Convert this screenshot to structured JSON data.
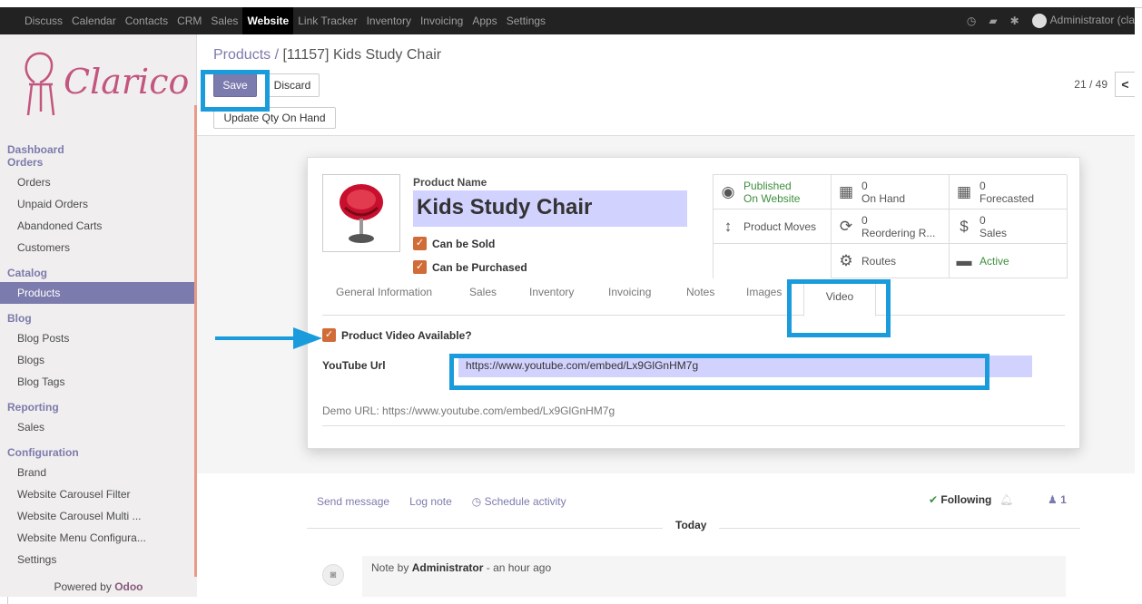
{
  "topnav": {
    "items": [
      "Discuss",
      "Calendar",
      "Contacts",
      "CRM",
      "Sales",
      "Website",
      "Link Tracker",
      "Inventory",
      "Invoicing",
      "Apps",
      "Settings"
    ],
    "active": "Website",
    "user": "Administrator (cla"
  },
  "sidebar": {
    "logo_text": "Clarico",
    "sections": {
      "dashboard": "Dashboard",
      "orders": "Orders",
      "orders_items": [
        "Orders",
        "Unpaid Orders",
        "Abandoned Carts",
        "Customers"
      ],
      "catalog": "Catalog",
      "catalog_items": [
        "Products"
      ],
      "blog": "Blog",
      "blog_items": [
        "Blog Posts",
        "Blogs",
        "Blog Tags"
      ],
      "reporting": "Reporting",
      "reporting_items": [
        "Sales"
      ],
      "configuration": "Configuration",
      "configuration_items": [
        "Brand",
        "Website Carousel Filter",
        "Website Carousel Multi ...",
        "Website Menu Configura...",
        "Settings"
      ]
    },
    "powered_prefix": "Powered by",
    "powered_brand": "Odoo"
  },
  "control_panel": {
    "breadcrumb_parent": "Products /",
    "breadcrumb_current": "[11157] Kids Study Chair",
    "save": "Save",
    "discard": "Discard",
    "update_qty": "Update Qty On Hand",
    "pager": "21 / 49",
    "pager_prev": "<"
  },
  "product": {
    "name_label": "Product Name",
    "name": "Kids Study Chair",
    "can_be_sold": "Can be Sold",
    "can_be_purchased": "Can be Purchased"
  },
  "stats": [
    {
      "icon": "globe-icon",
      "glyph": "◉",
      "line1": "Published",
      "line2": "On Website",
      "green": true
    },
    {
      "icon": "building-icon",
      "glyph": "▦",
      "line1": "0",
      "line2": "On Hand",
      "green": false
    },
    {
      "icon": "building-icon",
      "glyph": "▦",
      "line1": "0",
      "line2": "Forecasted",
      "green": false
    },
    {
      "icon": "arrows-vertical-icon",
      "glyph": "↕",
      "line1": "",
      "line2": "Product Moves",
      "green": false
    },
    {
      "icon": "refresh-icon",
      "glyph": "⟳",
      "line1": "0",
      "line2": "Reordering R...",
      "green": false
    },
    {
      "icon": "dollar-icon",
      "glyph": "$",
      "line1": "0",
      "line2": "Sales",
      "green": false
    },
    {
      "icon": "blank-icon",
      "glyph": "",
      "line1": "",
      "line2": "",
      "green": false
    },
    {
      "icon": "cogs-icon",
      "glyph": "⚙",
      "line1": "",
      "line2": "Routes",
      "green": false
    },
    {
      "icon": "archive-icon",
      "glyph": "▬",
      "line1": "",
      "line2": "Active",
      "green": true
    }
  ],
  "tabs": [
    "General Information",
    "Sales",
    "Inventory",
    "Invoicing",
    "Notes",
    "Images",
    "Video"
  ],
  "active_tab": "Video",
  "video": {
    "available_label": "Product Video Available?",
    "youtube_label": "YouTube Url",
    "youtube_url": "https://www.youtube.com/embed/Lx9GlGnHM7g",
    "demo": "Demo URL: https://www.youtube.com/embed/Lx9GlGnHM7g"
  },
  "chatter": {
    "send_message": "Send message",
    "log_note": "Log note",
    "schedule_activity": "Schedule activity",
    "following": "Following",
    "followers": "1",
    "today": "Today",
    "note_prefix": "Note by",
    "note_author": "Administrator",
    "note_time": "- an hour ago"
  },
  "colors": {
    "accent": "#7c7bad",
    "highlight": "#1a9bdb",
    "checkbox": "#d16b37",
    "input_bg": "#d2d2ff"
  }
}
